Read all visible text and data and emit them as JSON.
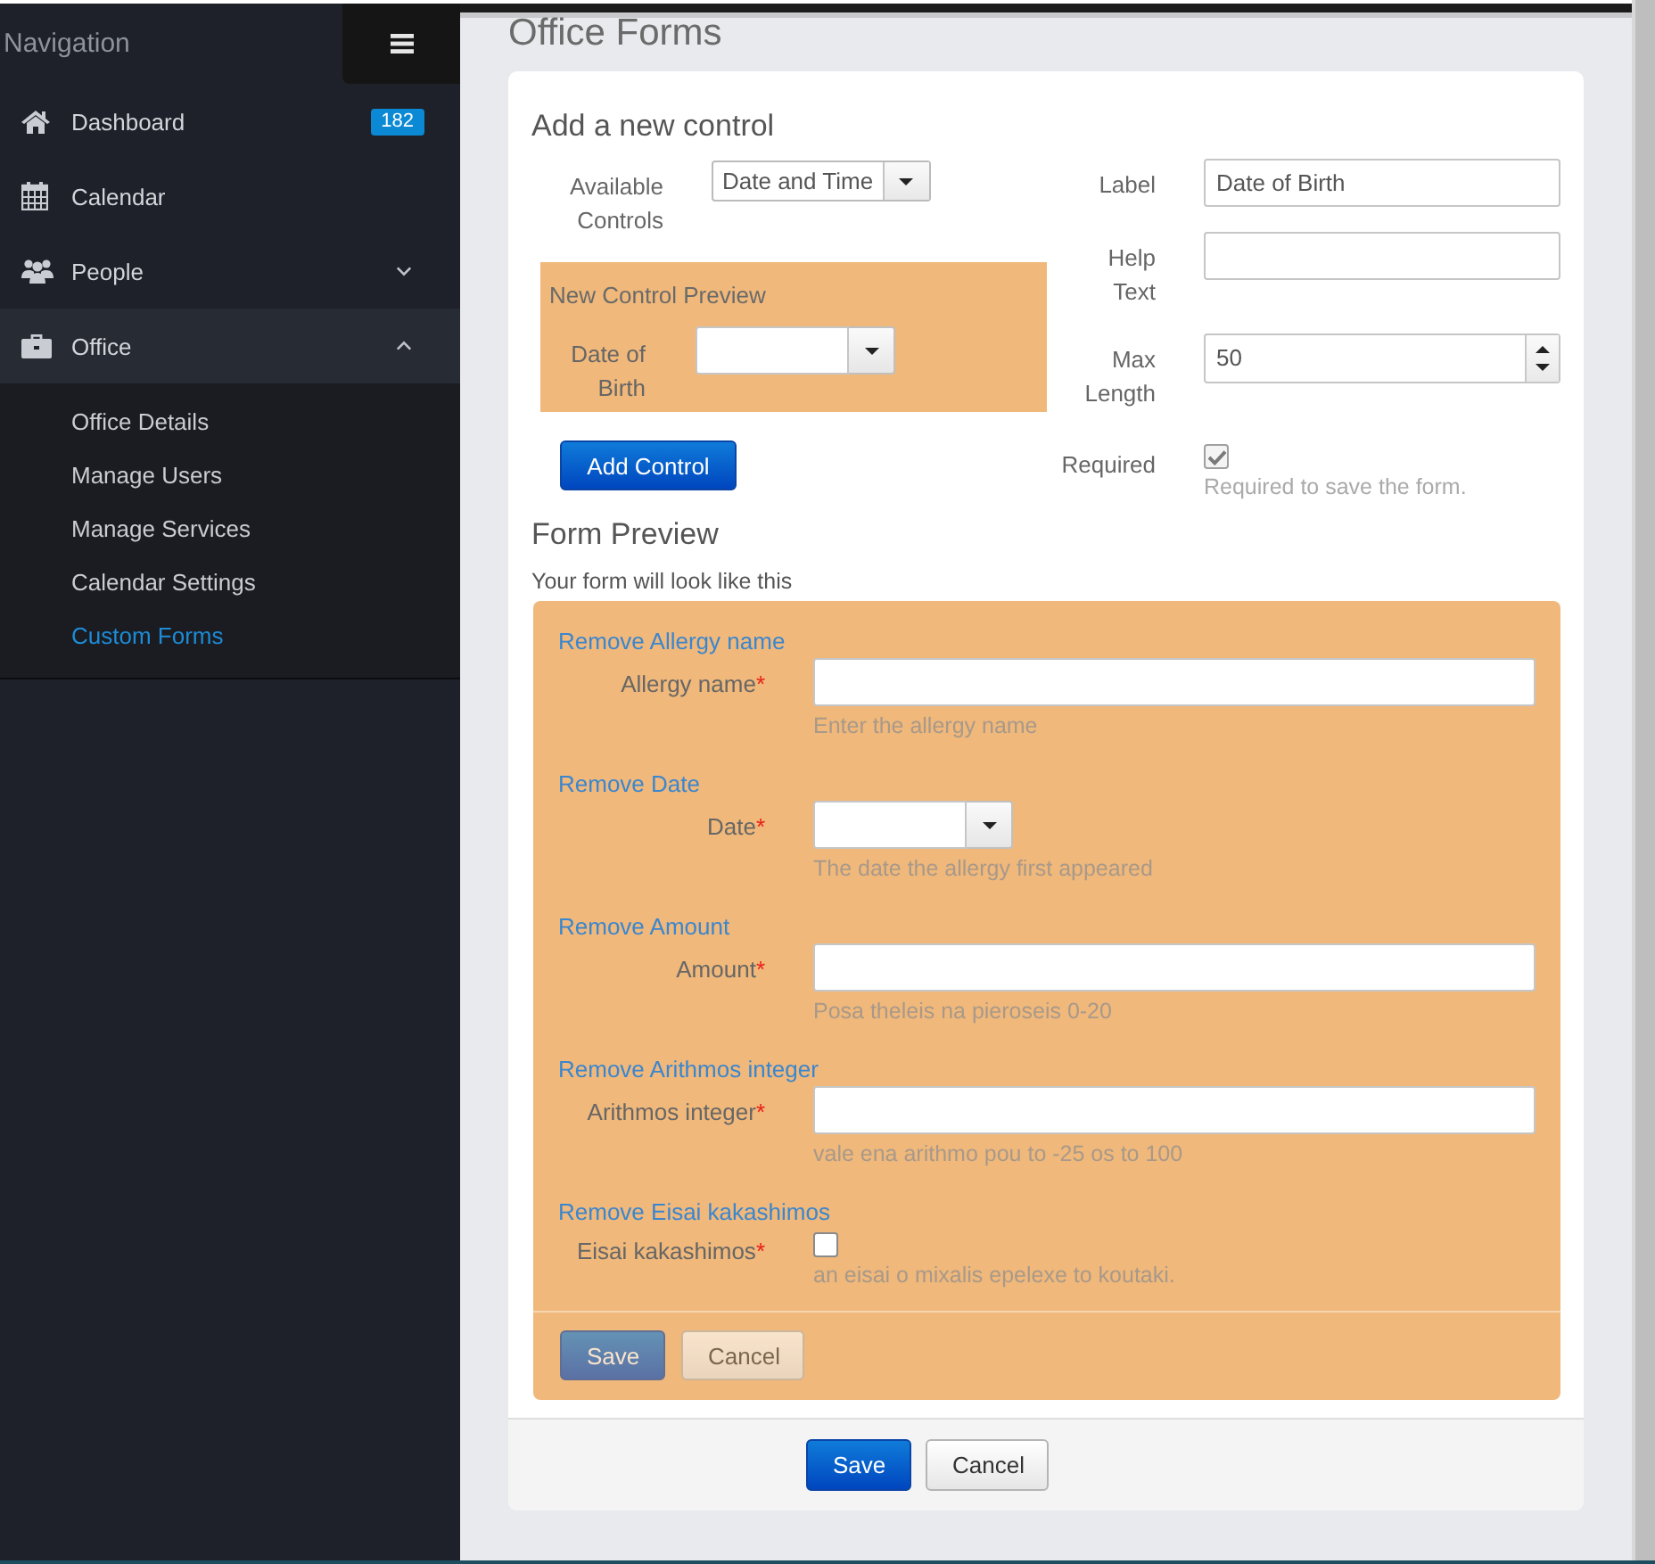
{
  "sidebar": {
    "title": "Navigation",
    "items": [
      {
        "label": "Dashboard",
        "kind": "link",
        "badge": "182"
      },
      {
        "label": "Calendar",
        "kind": "link"
      },
      {
        "label": "People",
        "kind": "group",
        "expanded": false
      },
      {
        "label": "Office",
        "kind": "group",
        "expanded": true,
        "children": [
          {
            "label": "Office Details",
            "selected": false
          },
          {
            "label": "Manage Users",
            "selected": false
          },
          {
            "label": "Manage Services",
            "selected": false
          },
          {
            "label": "Calendar Settings",
            "selected": false
          },
          {
            "label": "Custom Forms",
            "selected": true
          }
        ]
      }
    ]
  },
  "page_title": "Office Forms",
  "add_control": {
    "heading": "Add a new control",
    "available_controls": {
      "label": "Available Controls",
      "value": "Date and Time"
    },
    "preview": {
      "title": "New Control Preview",
      "control": {
        "kind": "date",
        "label": "Date of Birth"
      }
    },
    "add_button": "Add Control",
    "settings": [
      {
        "kind": "text",
        "label": "Label",
        "value": "Date of Birth"
      },
      {
        "kind": "text",
        "label": "Help Text"
      },
      {
        "kind": "number",
        "label": "Max Length",
        "value": "50"
      },
      {
        "kind": "checkbox",
        "label": "Required",
        "checked": true,
        "help": "Required to save the form."
      }
    ]
  },
  "form_preview": {
    "heading": "Form Preview",
    "subtitle": "Your form will look like this",
    "controls": [
      {
        "kind": "text",
        "remove_link": "Remove Allergy name",
        "label": "Allergy name",
        "required_mark": "*",
        "help": "Enter the allergy name"
      },
      {
        "kind": "date",
        "remove_link": "Remove Date",
        "label": "Date",
        "required_mark": "*",
        "help": "The date the allergy first appeared"
      },
      {
        "kind": "text",
        "remove_link": "Remove Amount",
        "label": "Amount",
        "required_mark": "*",
        "help": "Posa theleis na pieroseis 0-20"
      },
      {
        "kind": "text",
        "remove_link": "Remove Arithmos integer",
        "label": "Arithmos integer",
        "required_mark": "*",
        "help": "vale ena arithmo pou to -25 os to 100"
      },
      {
        "kind": "checkbox",
        "remove_link": "Remove Eisai kakashimos",
        "label": "Eisai kakashimos",
        "required_mark": "*",
        "checked": false,
        "help": "an eisai o mixalis epelexe to koutaki."
      }
    ],
    "buttons": [
      {
        "kind": "primary",
        "label": "Save",
        "disabled": true
      },
      {
        "kind": "default",
        "label": "Cancel",
        "disabled": true
      }
    ]
  },
  "footer_buttons": [
    {
      "kind": "primary",
      "label": "Save",
      "disabled": false
    },
    {
      "kind": "default",
      "label": "Cancel",
      "disabled": false
    }
  ]
}
